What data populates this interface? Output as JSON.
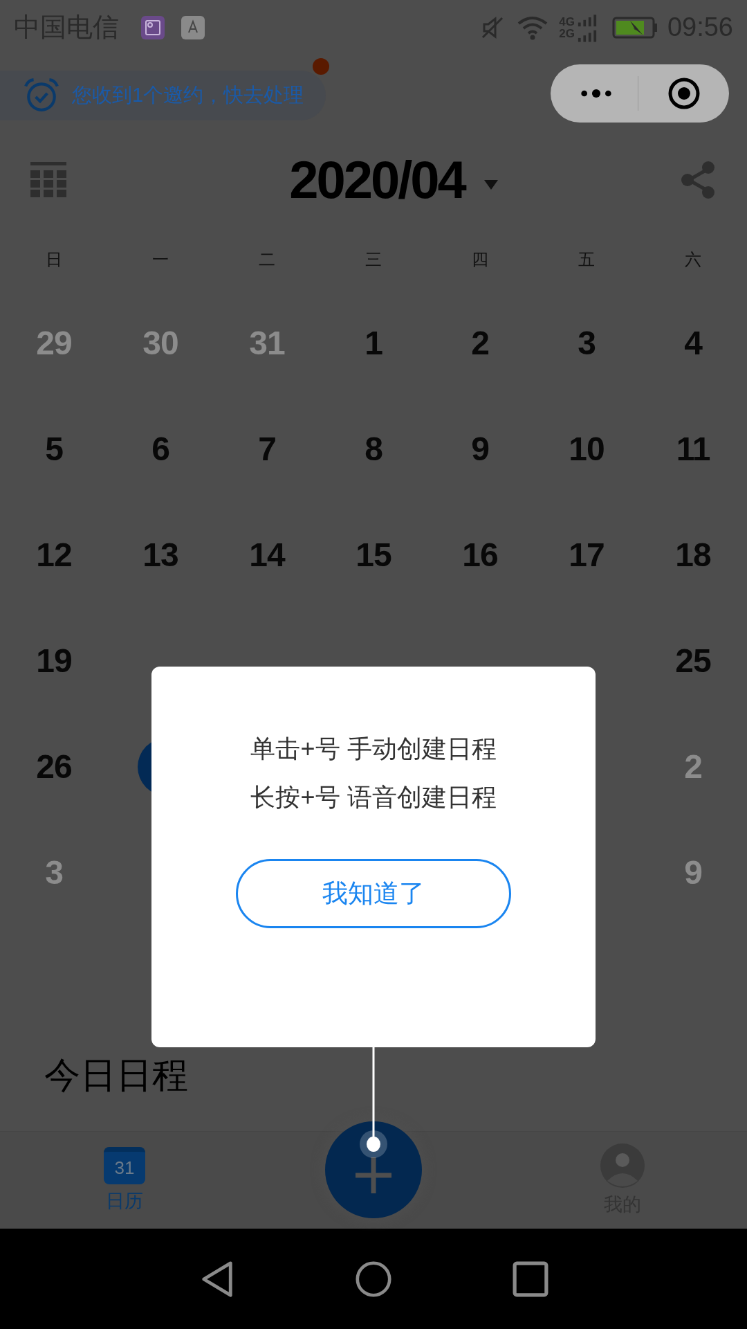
{
  "status_bar": {
    "carrier": "中国电信",
    "network_labels": [
      "4G",
      "2G"
    ],
    "time": "09:56"
  },
  "notice": {
    "text": "您收到1个邀约，快去处理",
    "unread": true
  },
  "header": {
    "title": "2020/04"
  },
  "weekdays": [
    "日",
    "一",
    "二",
    "三",
    "四",
    "五",
    "六"
  ],
  "weeks": [
    {
      "days_left": [
        {
          "day": "29",
          "other_month": true,
          "selected": false
        },
        {
          "day": "30",
          "other_month": true,
          "selected": false
        },
        {
          "day": "31",
          "other_month": true,
          "selected": false
        },
        {
          "day": "1",
          "other_month": false,
          "selected": false
        },
        {
          "day": "2",
          "other_month": false,
          "selected": false
        },
        {
          "day": "3",
          "other_month": false,
          "selected": false
        },
        {
          "day": "4",
          "other_month": false,
          "selected": false
        }
      ]
    },
    {
      "days_left": [
        {
          "day": "5",
          "other_month": false,
          "selected": false
        },
        {
          "day": "6",
          "other_month": false,
          "selected": false
        },
        {
          "day": "7",
          "other_month": false,
          "selected": false
        },
        {
          "day": "8",
          "other_month": false,
          "selected": false
        },
        {
          "day": "9",
          "other_month": false,
          "selected": false
        },
        {
          "day": "10",
          "other_month": false,
          "selected": false
        },
        {
          "day": "11",
          "other_month": false,
          "selected": false
        }
      ]
    },
    {
      "days_left": [
        {
          "day": "12",
          "other_month": false,
          "selected": false
        },
        {
          "day": "13",
          "other_month": false,
          "selected": false
        },
        {
          "day": "14",
          "other_month": false,
          "selected": false
        },
        {
          "day": "15",
          "other_month": false,
          "selected": false
        },
        {
          "day": "16",
          "other_month": false,
          "selected": false
        },
        {
          "day": "17",
          "other_month": false,
          "selected": false
        },
        {
          "day": "18",
          "other_month": false,
          "selected": false
        }
      ]
    },
    {
      "days_left": [
        {
          "day": "19",
          "other_month": false,
          "selected": false
        }
      ],
      "days_right": [
        {
          "day": "25",
          "other_month": false,
          "selected": false
        }
      ]
    },
    {
      "days_left": [
        {
          "day": "26",
          "other_month": false,
          "selected": false
        },
        {
          "selected": true
        }
      ],
      "days_right": [
        {
          "day": "2",
          "other_month": true,
          "selected": false
        }
      ]
    },
    {
      "days_left": [
        {
          "day": "3",
          "other_month": true,
          "selected": false
        }
      ],
      "days_right": [
        {
          "day": "9",
          "other_month": true,
          "selected": false
        }
      ]
    }
  ],
  "dialog": {
    "lines": [
      "单击+号 手动创建日程",
      "长按+号 语音创建日程"
    ],
    "button": "我知道了"
  },
  "section_title": "今日日程",
  "tabs": [
    {
      "kind": "calendar",
      "icon_label": "31",
      "label": "日历",
      "selected": true
    },
    {
      "kind": "profile",
      "label": "我的",
      "selected": false
    }
  ]
}
